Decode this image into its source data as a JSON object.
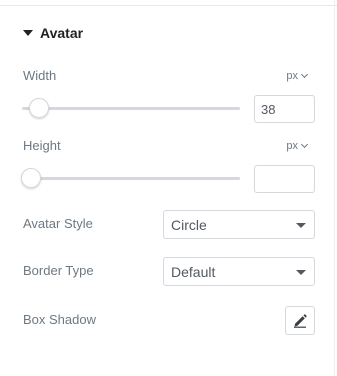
{
  "section": {
    "title": "Avatar",
    "expanded": true
  },
  "width": {
    "label": "Width",
    "unit": "px",
    "value": "38",
    "slider_fraction": 0.04
  },
  "height": {
    "label": "Height",
    "unit": "px",
    "value": "",
    "slider_fraction": 0.0
  },
  "avatar_style": {
    "label": "Avatar Style",
    "selected": "Circle"
  },
  "border_type": {
    "label": "Border Type",
    "selected": "Default"
  },
  "box_shadow": {
    "label": "Box Shadow",
    "button_icon": "pencil-icon"
  }
}
